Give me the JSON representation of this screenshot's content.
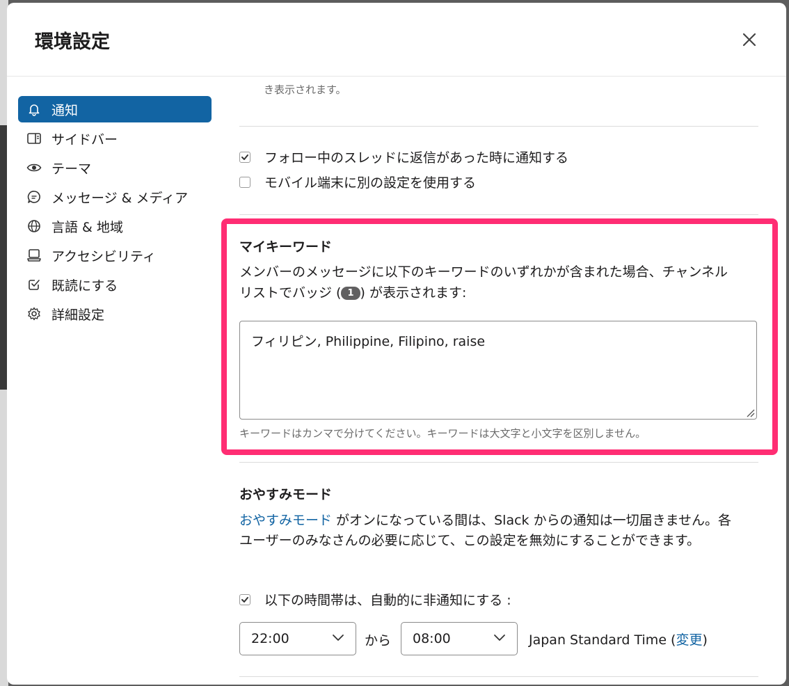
{
  "dialog": {
    "title": "環境設定"
  },
  "sidebar": {
    "items": [
      {
        "label": "通知",
        "icon": "bell-icon",
        "active": true
      },
      {
        "label": "サイドバー",
        "icon": "sidebar-icon"
      },
      {
        "label": "テーマ",
        "icon": "eye-icon"
      },
      {
        "label": "メッセージ & メディア",
        "icon": "message-icon"
      },
      {
        "label": "言語 & 地域",
        "icon": "globe-icon"
      },
      {
        "label": "アクセシビリティ",
        "icon": "laptop-icon"
      },
      {
        "label": "既読にする",
        "icon": "check-square-icon"
      },
      {
        "label": "詳細設定",
        "icon": "gear-icon"
      }
    ]
  },
  "content": {
    "faded_text": "き表示されます。",
    "options": {
      "thread_reply": {
        "label": "フォロー中のスレッドに返信があった時に通知する",
        "checked": true
      },
      "mobile_settings": {
        "label": "モバイル端末に別の設定を使用する",
        "checked": false
      }
    },
    "keywords": {
      "title": "マイキーワード",
      "desc_before": "メンバーのメッセージに以下のキーワードのいずれかが含まれた場合、チャンネルリストでバッジ (",
      "badge": "1",
      "desc_after": ") が表示されます:",
      "value": "フィリピン, Philippine, Filipino, raise",
      "hint": "キーワードはカンマで分けてください。キーワードは大文字と小文字を区別しません。"
    },
    "dnd": {
      "title": "おやすみモード",
      "link": "おやすみモード",
      "desc": " がオンになっている間は、Slack からの通知は一切届きません。各ユーザーのみなさんの必要に応じて、この設定を無効にすることができます。",
      "schedule_label": "以下の時間帯は、自動的に非通知にする :",
      "schedule_checked": true,
      "from_time": "22:00",
      "from_label": "から",
      "to_time": "08:00",
      "timezone": "Japan Standard Time (",
      "change_link": "変更",
      "timezone_close": ")"
    }
  },
  "colors": {
    "accent": "#1264a3",
    "highlight": "#ff2d73"
  }
}
